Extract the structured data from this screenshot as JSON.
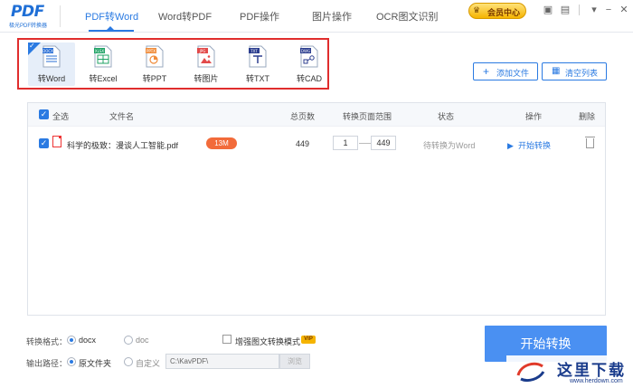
{
  "logo": {
    "main": "PDF",
    "sub": "极光PDF转换器"
  },
  "nav": {
    "tabs": [
      {
        "label": "PDF转Word",
        "active": true
      },
      {
        "label": "Word转PDF"
      },
      {
        "label": "PDF操作"
      },
      {
        "label": "图片操作"
      },
      {
        "label": "OCR图文识别"
      }
    ],
    "vip_label": "会员中心"
  },
  "window_controls": [
    "monitor-icon",
    "message-icon",
    "minimize-icon",
    "close-icon"
  ],
  "tools": [
    {
      "label": "转Word",
      "tag": "DOCX",
      "color": "#2a6fd6",
      "active": true
    },
    {
      "label": "转Excel",
      "tag": "XLSX",
      "color": "#21a366"
    },
    {
      "label": "转PPT",
      "tag": "PPTX",
      "color": "#f08c3a"
    },
    {
      "label": "转图片",
      "tag": "JPG",
      "color": "#e24a4a"
    },
    {
      "label": "转TXT",
      "tag": "TXT",
      "color": "#2c3e8f"
    },
    {
      "label": "转CAD",
      "tag": "DWG",
      "color": "#2c3e8f"
    }
  ],
  "actions": {
    "add_file": "添加文件",
    "clear_list": "清空列表"
  },
  "table": {
    "headers": {
      "select_all": "全选",
      "file_name": "文件名",
      "total_pages": "总页数",
      "page_range": "转换页面范围",
      "status": "状态",
      "action": "操作",
      "delete": "删除"
    },
    "rows": [
      {
        "file_name": "科学的极致：漫谈人工智能.pdf",
        "size": "13M",
        "total_pages": "449",
        "range_start": "1",
        "range_end": "449",
        "status": "待转换为Word",
        "action": "开始转换"
      }
    ]
  },
  "bottom": {
    "format_label": "转换格式：",
    "format_docx": "docx",
    "format_doc": "doc",
    "enhance_label": "增强图文转换模式",
    "vip_tag": "VIP",
    "output_label": "输出路径：",
    "output_source": "原文件夹",
    "output_custom": "自定义",
    "custom_path": "C:\\KavPDF\\",
    "browse": "浏览",
    "start": "开始转换"
  },
  "watermark": {
    "text": "这里下载",
    "url": "www.herdown.com"
  },
  "colors": {
    "accent": "#2a7ae2",
    "frame": "#e02d2d",
    "start": "#4a90f2",
    "badge": "#f26b3a"
  }
}
